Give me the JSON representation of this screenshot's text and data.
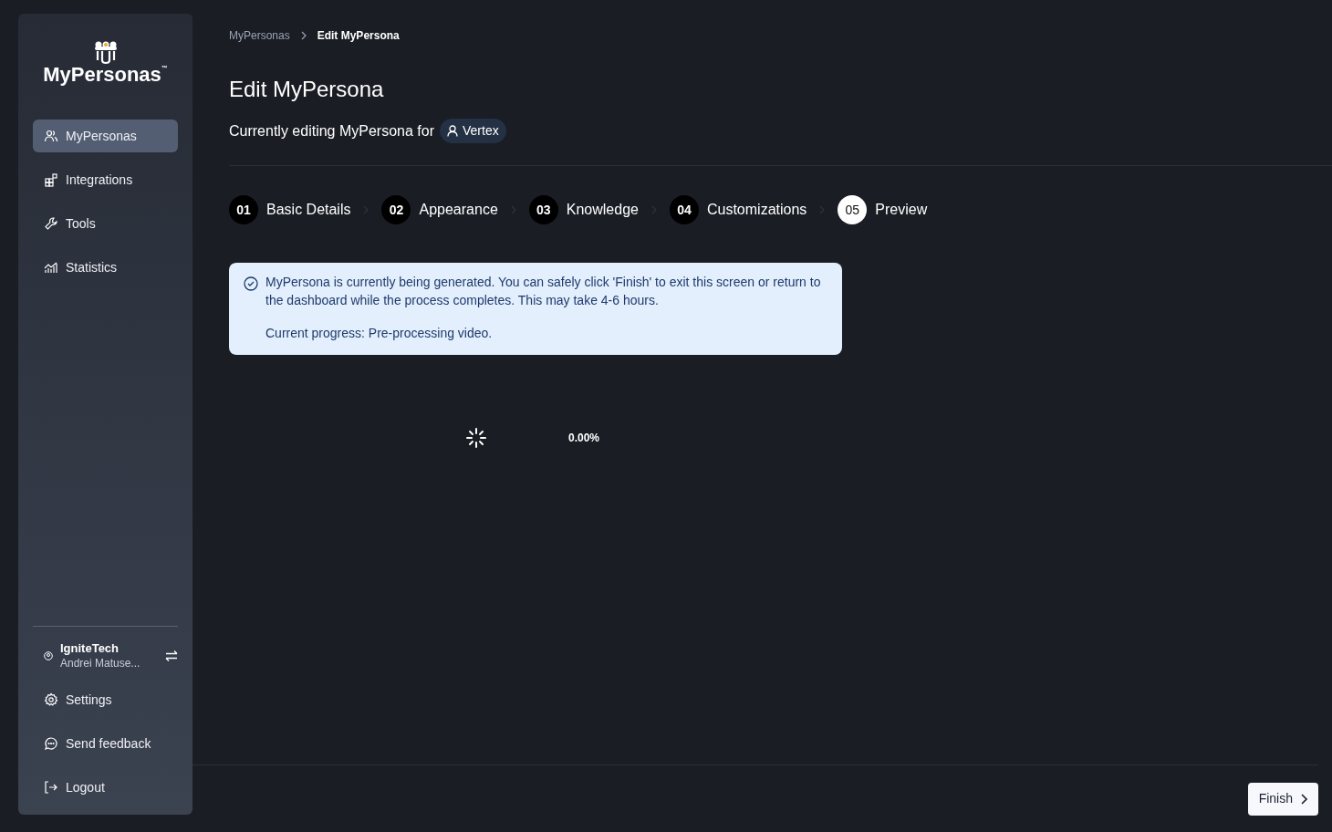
{
  "sidebar": {
    "logo": {
      "text": "MyPersonas",
      "trademark": "™"
    },
    "items": [
      {
        "label": "MyPersonas",
        "selected": true
      },
      {
        "label": "Integrations",
        "selected": false
      },
      {
        "label": "Tools",
        "selected": false
      },
      {
        "label": "Statistics",
        "selected": false
      }
    ],
    "account": {
      "org": "IgniteTech",
      "user": "Andrei Matuse..."
    },
    "bottom_items": [
      {
        "label": "Settings"
      },
      {
        "label": "Send feedback"
      },
      {
        "label": "Logout"
      }
    ]
  },
  "breadcrumb": [
    {
      "label": "MyPersonas"
    },
    {
      "label": "Edit MyPersona"
    }
  ],
  "title": "Edit MyPersona",
  "subtitle": {
    "text": "Currently editing MyPersona for",
    "persona": "Vertex"
  },
  "steps": [
    {
      "number": "01",
      "label": "Basic Details",
      "selected": false
    },
    {
      "number": "02",
      "label": "Appearance",
      "selected": false
    },
    {
      "number": "03",
      "label": "Knowledge",
      "selected": false
    },
    {
      "number": "04",
      "label": "Customizations",
      "selected": false
    },
    {
      "number": "05",
      "label": "Preview",
      "selected": true
    }
  ],
  "alert": {
    "message": "MyPersona is currently being generated. You can safely click 'Finish' to exit this screen or return to the dashboard while the process completes. This may take 4-6 hours.",
    "progress": "Current progress: Pre-processing video."
  },
  "progress_percent": "0.00%",
  "finish_button": "Finish"
}
